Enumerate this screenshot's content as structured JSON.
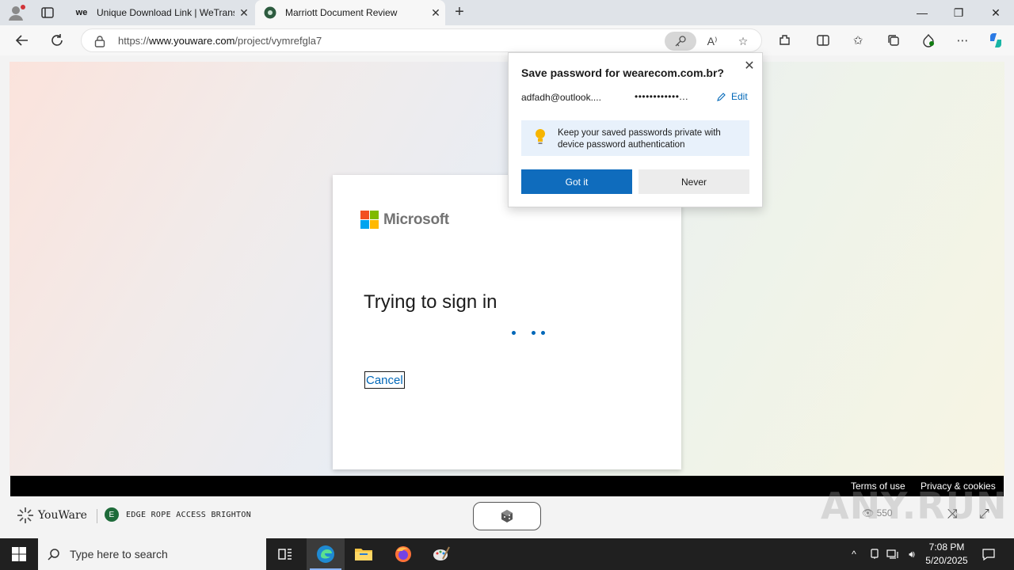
{
  "browser": {
    "tabs": [
      {
        "title": "Unique Download Link | WeTransfer",
        "favicon_text": "we",
        "active": false
      },
      {
        "title": "Marriott Document Review",
        "active": true
      }
    ],
    "url_prefix": "https://",
    "url_host": "www.youware.com",
    "url_path": "/project/vymrefgla7"
  },
  "page": {
    "brand_name": "Microsoft",
    "heading": "Trying to sign in",
    "cancel_label": "Cancel",
    "footer_terms": "Terms of use",
    "footer_privacy": "Privacy & cookies"
  },
  "password_popup": {
    "title": "Save password for wearecom.com.br?",
    "username": "adfadh@outlook....",
    "password_mask": "••••••••••••...",
    "edit_label": "Edit",
    "tip_line1": "Keep your saved passwords private with",
    "tip_line2": "device password authentication",
    "got_it_label": "Got it",
    "never_label": "Never"
  },
  "youware": {
    "logo_text": "YouWare",
    "project_initial": "E",
    "project_name": "EDGE ROPE ACCESS BRIGHTON",
    "view_count": "550"
  },
  "watermark": "ANY.RUN",
  "taskbar": {
    "search_placeholder": "Type here to search",
    "time": "7:08 PM",
    "date": "5/20/2025"
  },
  "colors": {
    "ms_red": "#f25022",
    "ms_green": "#7fba00",
    "ms_blue": "#00a4ef",
    "ms_yellow": "#ffb900",
    "accent_blue": "#0067b8",
    "edge_button_blue": "#0f6cbd"
  }
}
